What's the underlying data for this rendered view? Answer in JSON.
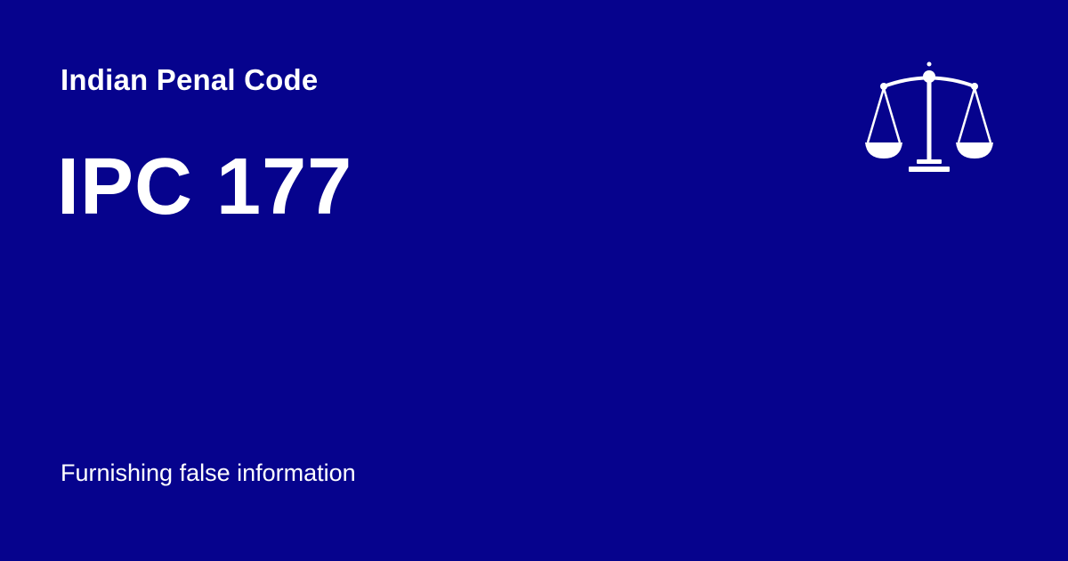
{
  "page": {
    "background_color": "#06038d",
    "text_color": "#ffffff"
  },
  "header": {
    "eyebrow": "Indian Penal Code",
    "title": "IPC 177"
  },
  "footer": {
    "description": "Furnishing false information"
  },
  "icons": {
    "emblem": "scales-of-justice-icon"
  }
}
